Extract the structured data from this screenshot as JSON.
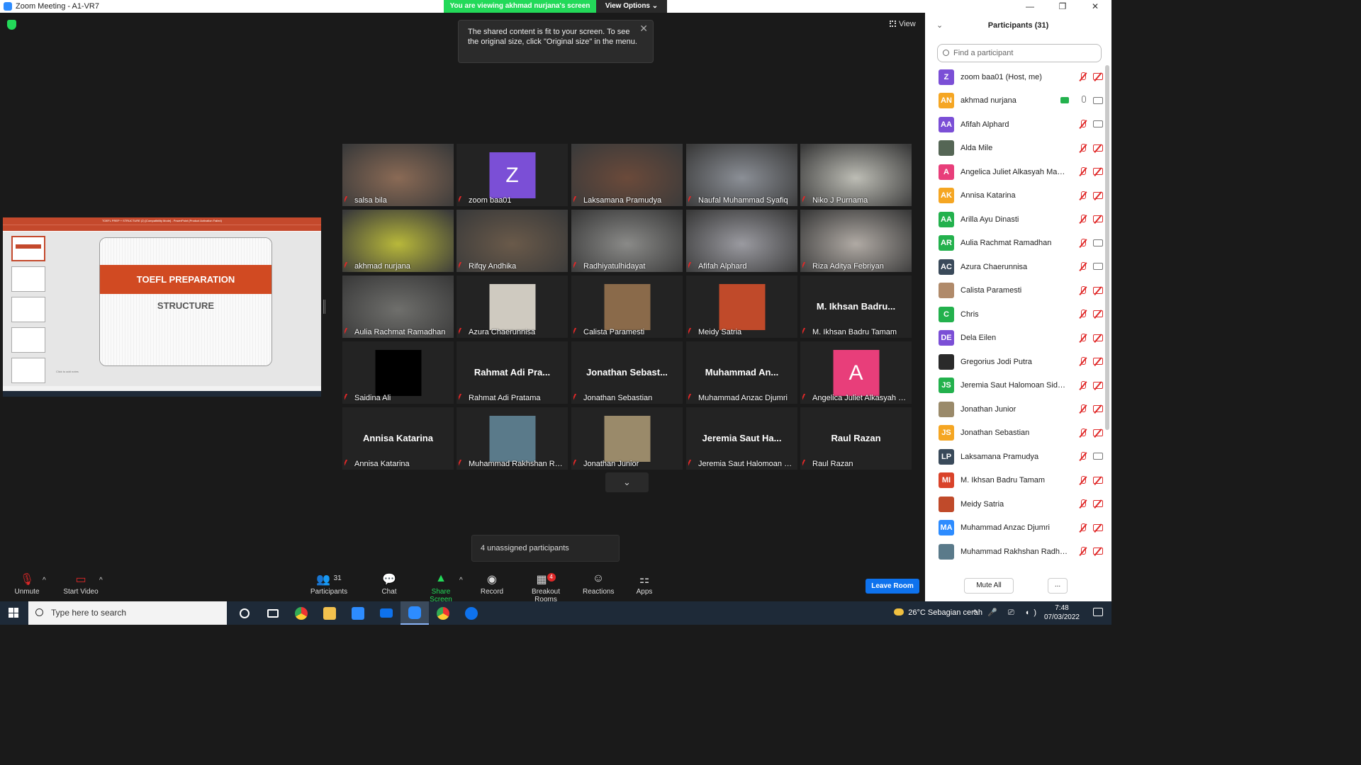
{
  "window": {
    "title": "Zoom Meeting - A1-VR7",
    "minimize": "—",
    "maximize": "❐",
    "close": "✕"
  },
  "banner": {
    "viewing": "You are viewing akhmad nurjana's screen",
    "view_options": "View Options ⌄"
  },
  "view_button": "View",
  "tooltip": {
    "text": "The shared content is fit to your screen. To see the original size, click \"Original size\" in the menu.",
    "close": "✕"
  },
  "shared_screen": {
    "slide_title": "TOEFL PREPARATION",
    "slide_subtitle": "STRUCTURE",
    "notes": "Click to add notes",
    "app_title": "TOEFL PREP + STRUCTURE (2) [Compatibility Mode] - PowerPoint (Product Activation Failed)"
  },
  "tiles": [
    {
      "name": "salsa bila",
      "type": "video",
      "color": "#8a6a55"
    },
    {
      "name": "zoom baa01",
      "type": "avatar",
      "letter": "Z",
      "avatar_color": "#7b4fd6"
    },
    {
      "name": "Laksamana Pramudya",
      "type": "video",
      "color": "#6b4a3a"
    },
    {
      "name": "Naufal Muhammad Syafiq",
      "type": "video",
      "color": "#8b8f96"
    },
    {
      "name": "Niko J Purnama",
      "type": "video",
      "color": "#bdbdb5"
    },
    {
      "name": "akhmad nurjana",
      "type": "video",
      "color": "#b8b83a",
      "speaking": true
    },
    {
      "name": "Rifqy Andhika",
      "type": "video",
      "color": "#6a5a4a"
    },
    {
      "name": "Radhiyatulhidayat",
      "type": "video",
      "color": "#8a8a88"
    },
    {
      "name": "Afifah Alphard",
      "type": "video",
      "color": "#9a9aa0"
    },
    {
      "name": "Riza Aditya Febriyan",
      "type": "video",
      "color": "#b0aaa4"
    },
    {
      "name": "Aulia Rachmat Ramadhan",
      "type": "video",
      "color": "#6f6f6c"
    },
    {
      "name": "Azura Chaerunnisa",
      "type": "photo",
      "color": "#cfcac0"
    },
    {
      "name": "Calista Paramesti",
      "type": "photo",
      "color": "#8a6a4a"
    },
    {
      "name": "Meidy Satria",
      "type": "photo",
      "color": "#c04a2a"
    },
    {
      "name": "M. Ikhsan Badru Tamam",
      "type": "name",
      "display": "M. Ikhsan Badru..."
    },
    {
      "name": "Saidina Ali",
      "type": "photo",
      "color": "#000000"
    },
    {
      "name": "Rahmat Adi Pratama",
      "type": "name",
      "display": "Rahmat Adi Pra..."
    },
    {
      "name": "Jonathan Sebastian",
      "type": "name",
      "display": "Jonathan Sebast..."
    },
    {
      "name": "Muhammad Anzac Djumri",
      "type": "name",
      "display": "Muhammad An..."
    },
    {
      "name": "Angelica Juliet Alkasyah M...",
      "type": "avatar",
      "letter": "A",
      "avatar_color": "#e83e7a"
    },
    {
      "name": "Annisa Katarina",
      "type": "name",
      "display": "Annisa Katarina"
    },
    {
      "name": "Muhammad Rakhshan Rad...",
      "type": "photo",
      "color": "#5a7a8a"
    },
    {
      "name": "Jonathan Junior",
      "type": "photo",
      "color": "#9a8a6a"
    },
    {
      "name": "Jeremia Saut Halomoan Si...",
      "type": "name",
      "display": "Jeremia Saut Ha..."
    },
    {
      "name": "Raul Razan",
      "type": "name",
      "display": "Raul Razan"
    }
  ],
  "more_arrow": "⌄",
  "unassigned": "4 unassigned participants",
  "toolbar": {
    "unmute": "Unmute",
    "start_video": "Start Video",
    "participants": "Participants",
    "participants_count": "31",
    "chat": "Chat",
    "share_screen": "Share Screen",
    "record": "Record",
    "breakout_rooms": "Breakout Rooms",
    "breakout_badge": "4",
    "reactions": "Reactions",
    "apps": "Apps",
    "leave_room": "Leave Room",
    "caret": "^"
  },
  "panel": {
    "title": "Participants (31)",
    "collapse": "⌄",
    "search_placeholder": "Find a participant",
    "mute_all": "Mute All",
    "more": "...",
    "participants": [
      {
        "name": "zoom baa01 (Host, me)",
        "initials": "Z",
        "color": "#7b4fd6",
        "cam": "off"
      },
      {
        "name": "akhmad nurjana",
        "initials": "AN",
        "color": "#f5a623",
        "cam": "on",
        "sharing": true
      },
      {
        "name": "Afifah Alphard",
        "initials": "AA",
        "color": "#7b4fd6",
        "cam": "on"
      },
      {
        "name": "Alda Mile",
        "initials": "",
        "color": "#556655",
        "cam": "off"
      },
      {
        "name": "Angelica Juliet Alkasyah Massie",
        "initials": "A",
        "color": "#e83e7a",
        "cam": "off"
      },
      {
        "name": "Annisa Katarina",
        "initials": "AK",
        "color": "#f5a623",
        "cam": "off"
      },
      {
        "name": "Arilla Ayu Dinasti",
        "initials": "AA",
        "color": "#23b14d",
        "cam": "off"
      },
      {
        "name": "Aulia Rachmat Ramadhan",
        "initials": "AR",
        "color": "#23b14d",
        "cam": "on"
      },
      {
        "name": "Azura Chaerunnisa",
        "initials": "AC",
        "color": "#3a4a5a",
        "cam": "on"
      },
      {
        "name": "Calista Paramesti",
        "initials": "",
        "color": "#b08a6a",
        "cam": "off"
      },
      {
        "name": "Chris",
        "initials": "C",
        "color": "#23b14d",
        "cam": "off"
      },
      {
        "name": "Dela Eilen",
        "initials": "DE",
        "color": "#7b4fd6",
        "cam": "off"
      },
      {
        "name": "Gregorius Jodi Putra",
        "initials": "",
        "color": "#2a2a2a",
        "cam": "off"
      },
      {
        "name": "Jeremia Saut Halomoan Sidaur...",
        "initials": "JS",
        "color": "#23b14d",
        "cam": "off"
      },
      {
        "name": "Jonathan Junior",
        "initials": "",
        "color": "#9a8a6a",
        "cam": "off"
      },
      {
        "name": "Jonathan Sebastian",
        "initials": "JS",
        "color": "#f5a623",
        "cam": "off"
      },
      {
        "name": "Laksamana Pramudya",
        "initials": "LP",
        "color": "#3a4a5a",
        "cam": "on"
      },
      {
        "name": "M. Ikhsan Badru Tamam",
        "initials": "MI",
        "color": "#d9432a",
        "cam": "off"
      },
      {
        "name": "Meidy Satria",
        "initials": "",
        "color": "#c04a2a",
        "cam": "off"
      },
      {
        "name": "Muhammad Anzac Djumri",
        "initials": "MA",
        "color": "#2d8cff",
        "cam": "off"
      },
      {
        "name": "Muhammad Rakhshan Radhian...",
        "initials": "",
        "color": "#5a7a8a",
        "cam": "off"
      }
    ]
  },
  "taskbar": {
    "search": "Type here to search",
    "weather": "26°C  Sebagian cerah",
    "tray": "^ 🎤 ⎚ ◖)",
    "time": "7:48",
    "date": "07/03/2022"
  }
}
